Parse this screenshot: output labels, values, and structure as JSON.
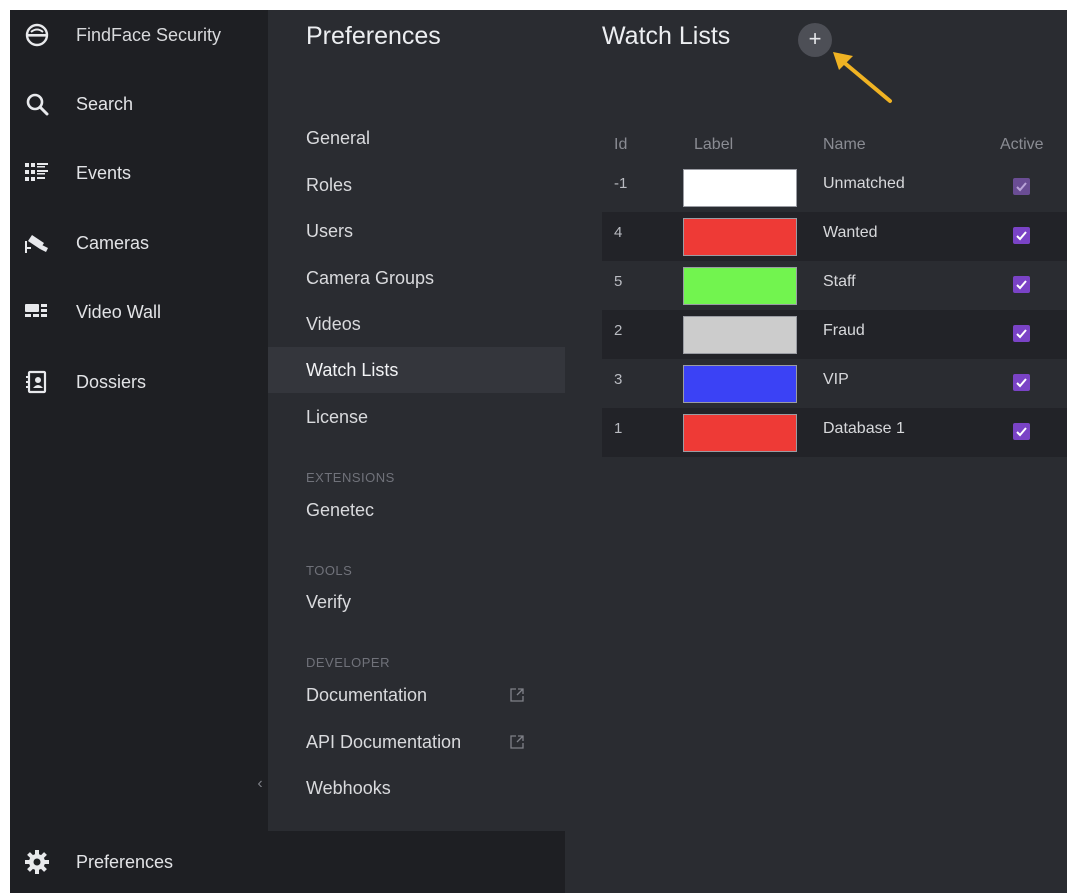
{
  "nav": {
    "brand": "FindFace Security",
    "items": [
      {
        "label": "Search",
        "icon": "search-icon"
      },
      {
        "label": "Events",
        "icon": "events-icon"
      },
      {
        "label": "Cameras",
        "icon": "camera-icon"
      },
      {
        "label": "Video Wall",
        "icon": "video-wall-icon"
      },
      {
        "label": "Dossiers",
        "icon": "dossier-icon"
      }
    ],
    "collapse": "‹",
    "bottom": {
      "label": "Preferences",
      "icon": "gear-icon"
    }
  },
  "prefs": {
    "title": "Preferences",
    "items": [
      "General",
      "Roles",
      "Users",
      "Camera Groups",
      "Videos",
      "Watch Lists",
      "License"
    ],
    "active": "Watch Lists",
    "extensions": {
      "header": "EXTENSIONS",
      "items": [
        "Genetec"
      ]
    },
    "tools": {
      "header": "TOOLS",
      "items": [
        "Verify"
      ]
    },
    "developer": {
      "header": "DEVELOPER",
      "items": [
        "Documentation",
        "API Documentation",
        "Webhooks"
      ]
    }
  },
  "main": {
    "title": "Watch Lists",
    "add": "+",
    "columns": {
      "id": "Id",
      "label": "Label",
      "name": "Name",
      "active": "Active"
    },
    "rows": [
      {
        "id": "-1",
        "color": "#ffffff",
        "name": "Unmatched",
        "active": true
      },
      {
        "id": "4",
        "color": "#ee3a36",
        "name": "Wanted",
        "active": true
      },
      {
        "id": "5",
        "color": "#72f44f",
        "name": "Staff",
        "active": true
      },
      {
        "id": "2",
        "color": "#cccccc",
        "name": "Fraud",
        "active": true
      },
      {
        "id": "3",
        "color": "#3b42f5",
        "name": "VIP",
        "active": true
      },
      {
        "id": "1",
        "color": "#ee3a36",
        "name": "Database 1",
        "active": true
      }
    ]
  },
  "colors": {
    "accent": "#7a43c6",
    "annotation_arrow": "#f0b323"
  }
}
